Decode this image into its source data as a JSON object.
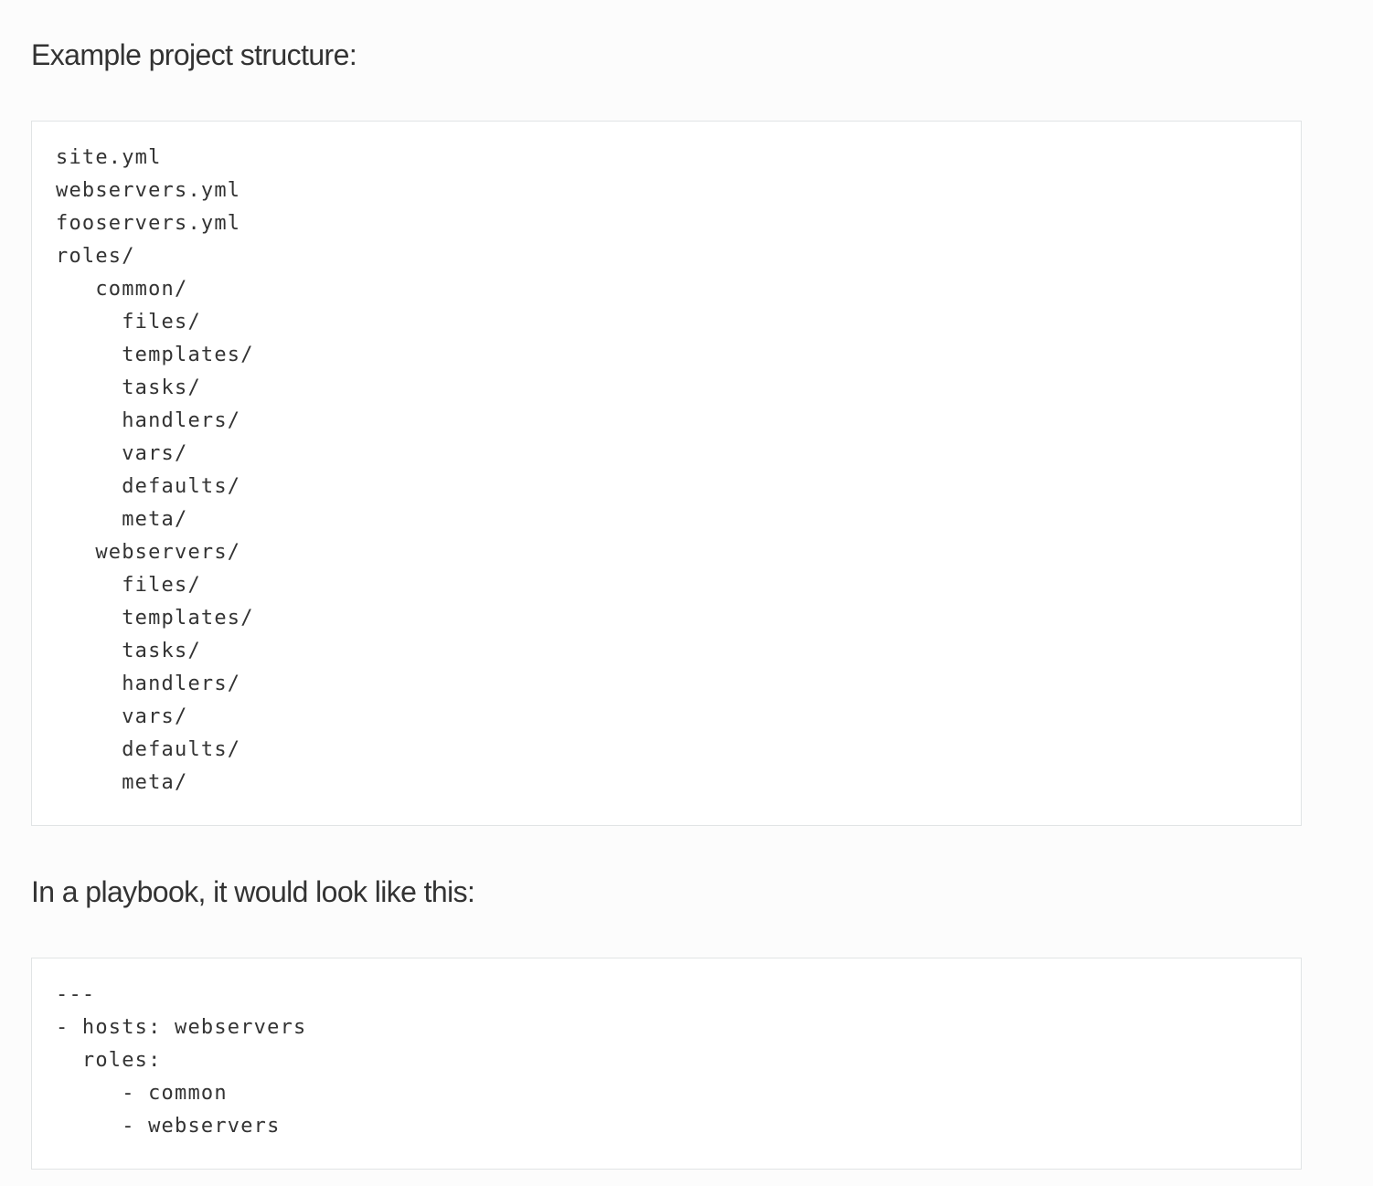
{
  "sections": [
    {
      "heading": "Example project structure:",
      "code_lines": [
        "site.yml",
        "webservers.yml",
        "fooservers.yml",
        "roles/",
        "   common/",
        "     files/",
        "     templates/",
        "     tasks/",
        "     handlers/",
        "     vars/",
        "     defaults/",
        "     meta/",
        "   webservers/",
        "     files/",
        "     templates/",
        "     tasks/",
        "     handlers/",
        "     vars/",
        "     defaults/",
        "     meta/"
      ]
    },
    {
      "heading": "In a playbook, it would look like this:",
      "code_lines": [
        "---",
        "- hosts: webservers",
        "  roles:",
        "     - common",
        "     - webservers"
      ]
    }
  ]
}
